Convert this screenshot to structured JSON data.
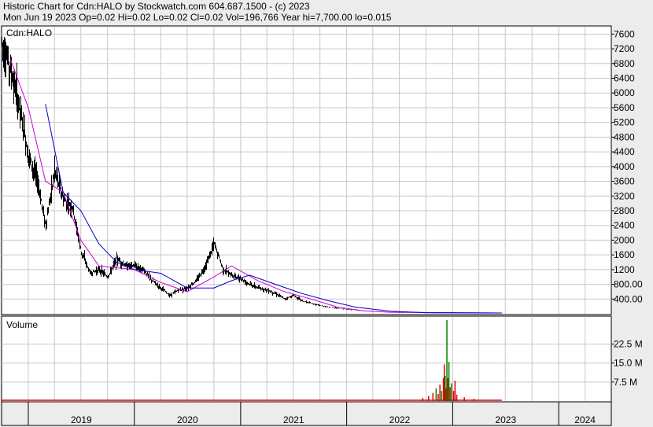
{
  "header": {
    "line1": "Historic Chart for Cdn:HALO by Stockwatch.com 604.687.1500 - (c) 2023",
    "line2": "Mon Jun 19 2023  Op=0.02  Hi=0.02  Lo=0.02  Cl=0.02  Vol=196,766  Year hi=7,700.00  lo=0.015"
  },
  "colors": {
    "background": "#ececec",
    "panel": "#ffffff",
    "price_bar": "#000000",
    "ma_short": "#d000d0",
    "ma_long": "#0000c8",
    "volume_up": "#008000",
    "volume_down": "#e00000",
    "grid": "#c8c8c8"
  },
  "chart_data": [
    {
      "type": "line",
      "panel_label": "Cdn:HALO",
      "y_ticks": [
        "7600",
        "7200",
        "6800",
        "6400",
        "6000",
        "5600",
        "5200",
        "4800",
        "4400",
        "4000",
        "3600",
        "3200",
        "2800",
        "2400",
        "2000",
        "1600",
        "1200",
        "800.00",
        "400.00"
      ],
      "ylim": [
        0,
        7800
      ],
      "x_ticks": [
        "2019",
        "2020",
        "2021",
        "2022",
        "2023",
        "2024"
      ],
      "x_range": [
        "2018-10-01",
        "2024-06-30"
      ],
      "grid": true,
      "series": [
        {
          "key": "price",
          "x": [
            "2018-10-01",
            "2018-11-01",
            "2018-12-01",
            "2019-01-01",
            "2019-02-01",
            "2019-03-01",
            "2019-04-01",
            "2019-05-01",
            "2019-06-01",
            "2019-07-01",
            "2019-08-01",
            "2019-09-01",
            "2019-10-01",
            "2019-11-01",
            "2019-12-01",
            "2020-01-01",
            "2020-02-01",
            "2020-03-01",
            "2020-04-01",
            "2020-05-01",
            "2020-06-01",
            "2020-07-01",
            "2020-08-01",
            "2020-09-01",
            "2020-10-01",
            "2020-11-01",
            "2020-12-01",
            "2021-01-01",
            "2021-02-01",
            "2021-03-01",
            "2021-04-01",
            "2021-05-01",
            "2021-06-01",
            "2021-07-01",
            "2021-08-01",
            "2021-09-01",
            "2021-10-01",
            "2021-11-01",
            "2021-12-01",
            "2022-01-01",
            "2022-02-01",
            "2022-03-01",
            "2022-04-01",
            "2022-05-01",
            "2022-06-01",
            "2022-07-01",
            "2022-08-01",
            "2022-09-01",
            "2022-10-01",
            "2022-11-01",
            "2022-12-01",
            "2023-01-01",
            "2023-02-01",
            "2023-03-01",
            "2023-04-01",
            "2023-05-01",
            "2023-06-19"
          ],
          "values": [
            7400,
            6600,
            5600,
            4300,
            3600,
            2400,
            3900,
            3100,
            2900,
            1700,
            1100,
            1200,
            1000,
            1500,
            1300,
            1300,
            1200,
            900,
            700,
            500,
            650,
            700,
            900,
            1300,
            1900,
            1200,
            1050,
            950,
            800,
            700,
            650,
            550,
            400,
            500,
            350,
            280,
            220,
            180,
            150,
            120,
            100,
            80,
            60,
            50,
            40,
            30,
            25,
            25,
            22,
            20,
            20,
            20,
            20,
            20,
            20,
            20,
            20
          ]
        },
        {
          "key": "ma_short",
          "x": [
            "2018-11-01",
            "2019-01-01",
            "2019-03-01",
            "2019-05-01",
            "2019-07-01",
            "2019-09-01",
            "2019-11-01",
            "2020-01-01",
            "2020-04-01",
            "2020-07-01",
            "2020-10-01",
            "2020-12-01",
            "2021-03-01",
            "2021-06-01",
            "2021-09-01",
            "2021-12-01",
            "2022-03-01",
            "2022-06-01",
            "2023-06-19"
          ],
          "values": [
            6900,
            5600,
            3600,
            3300,
            2000,
            1300,
            1250,
            1200,
            850,
            600,
            1000,
            1300,
            900,
            600,
            400,
            180,
            80,
            40,
            22
          ]
        },
        {
          "key": "ma_long",
          "x": [
            "2019-03-01",
            "2019-05-01",
            "2019-07-01",
            "2019-09-01",
            "2019-11-01",
            "2020-01-01",
            "2020-04-01",
            "2020-07-01",
            "2020-10-01",
            "2020-12-01",
            "2021-02-01",
            "2021-05-01",
            "2021-08-01",
            "2021-11-01",
            "2022-02-01",
            "2022-06-01",
            "2022-10-01",
            "2023-06-19"
          ],
          "values": [
            5700,
            3300,
            2800,
            1900,
            1400,
            1200,
            1100,
            700,
            700,
            900,
            1050,
            800,
            550,
            350,
            180,
            70,
            30,
            22
          ]
        }
      ]
    },
    {
      "type": "bar",
      "panel_label": "Volume",
      "y_ticks": [
        "22.5 M",
        "15.0 M",
        "7.5 M"
      ],
      "ylim": [
        0,
        32000000
      ],
      "x_range": [
        "2018-10-01",
        "2024-06-30"
      ],
      "bars": [
        {
          "x": "2022-09-20",
          "value": 1200000,
          "dir": "down"
        },
        {
          "x": "2022-10-10",
          "value": 2000000,
          "dir": "down"
        },
        {
          "x": "2022-10-25",
          "value": 3200000,
          "dir": "down"
        },
        {
          "x": "2022-11-05",
          "value": 5000000,
          "dir": "up"
        },
        {
          "x": "2022-11-12",
          "value": 2800000,
          "dir": "down"
        },
        {
          "x": "2022-11-18",
          "value": 6500000,
          "dir": "down"
        },
        {
          "x": "2022-11-24",
          "value": 4000000,
          "dir": "up"
        },
        {
          "x": "2022-11-30",
          "value": 9000000,
          "dir": "down"
        },
        {
          "x": "2022-12-03",
          "value": 14500000,
          "dir": "down"
        },
        {
          "x": "2022-12-06",
          "value": 10000000,
          "dir": "up"
        },
        {
          "x": "2022-12-09",
          "value": 5000000,
          "dir": "down"
        },
        {
          "x": "2022-12-12",
          "value": 32000000,
          "dir": "up"
        },
        {
          "x": "2022-12-15",
          "value": 9000000,
          "dir": "down"
        },
        {
          "x": "2022-12-19",
          "value": 15500000,
          "dir": "up"
        },
        {
          "x": "2022-12-23",
          "value": 5500000,
          "dir": "down"
        },
        {
          "x": "2022-12-28",
          "value": 7000000,
          "dir": "up"
        },
        {
          "x": "2023-01-04",
          "value": 4000000,
          "dir": "down"
        },
        {
          "x": "2023-01-09",
          "value": 8000000,
          "dir": "down"
        },
        {
          "x": "2023-01-15",
          "value": 2500000,
          "dir": "down"
        },
        {
          "x": "2023-02-10",
          "value": 1500000,
          "dir": "down"
        },
        {
          "x": "2023-03-15",
          "value": 900000,
          "dir": "down"
        }
      ]
    }
  ]
}
